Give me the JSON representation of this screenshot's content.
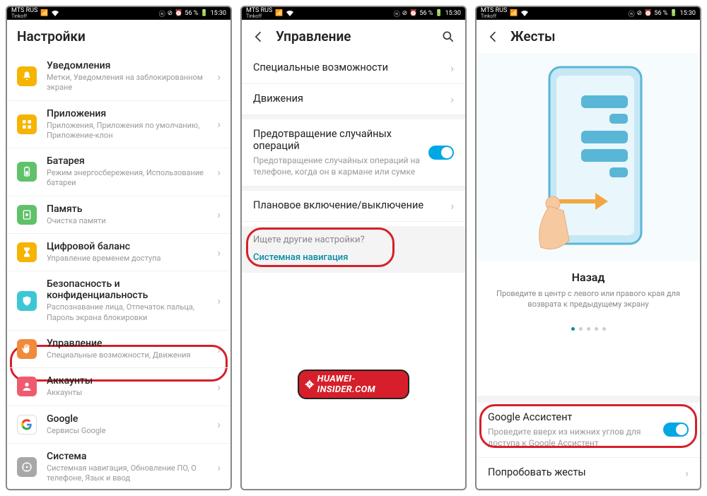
{
  "statusbar": {
    "carrier": "MTS RUS",
    "sub": "Tinkoff",
    "battery": "56 %",
    "time": "15:30"
  },
  "phone1": {
    "title": "Настройки",
    "items": [
      {
        "icon": "bell",
        "color": "#f6b400",
        "title": "Уведомления",
        "sub": "Метки, Уведомления на заблокированном экране"
      },
      {
        "icon": "grid",
        "color": "#f6b400",
        "title": "Приложения",
        "sub": "Приложения, Приложения по умолчанию, Приложение-клон"
      },
      {
        "icon": "battery",
        "color": "#5fc26a",
        "title": "Батарея",
        "sub": "Режим энергосбережения, Использование батареи"
      },
      {
        "icon": "memory",
        "color": "#5fc26a",
        "title": "Память",
        "sub": "Очистка памяти"
      },
      {
        "icon": "hourglass",
        "color": "#f6b400",
        "title": "Цифровой баланс",
        "sub": "Управление временем доступа"
      },
      {
        "icon": "shield",
        "color": "#3cc7d6",
        "title": "Безопасность и конфиденциальность",
        "sub": "Распознавание лица, Отпечаток пальца, Пароль экрана блокировки"
      },
      {
        "icon": "hand",
        "color": "#f08a3c",
        "title": "Управление",
        "sub": "Специальные возможности, Движения"
      },
      {
        "icon": "user",
        "color": "#ef5b6e",
        "title": "Аккаунты",
        "sub": "Аккаунты"
      },
      {
        "icon": "google",
        "color": "#ffffff",
        "title": "Google",
        "sub": "Сервисы Google"
      },
      {
        "icon": "system",
        "color": "#a8a8a8",
        "title": "Система",
        "sub": "Системная навигация, Обновление ПО, О телефоне, Язык и ввод"
      }
    ]
  },
  "phone2": {
    "title": "Управление",
    "items": {
      "access": "Специальные возможности",
      "motion": "Движения",
      "prevent_t": "Предотвращение случайных операций",
      "prevent_s": "Предотвращение случайных операций на телефоне, когда он в кармане или сумке",
      "sched": "Плановое включение/выключение"
    },
    "other_q": "Ищете другие настройки?",
    "other_link": "Системная навигация",
    "badge": "HUAWEI-INSIDER.COM"
  },
  "phone3": {
    "title": "Жесты",
    "gesture_title": "Назад",
    "gesture_desc": "Проведите в центр с левого или правого края для возврата к предыдущему экрану",
    "ga_title": "Google Ассистент",
    "ga_sub": "Проведите вверх из нижних углов для доступа к Google Ассистент",
    "try": "Попробовать жесты"
  }
}
